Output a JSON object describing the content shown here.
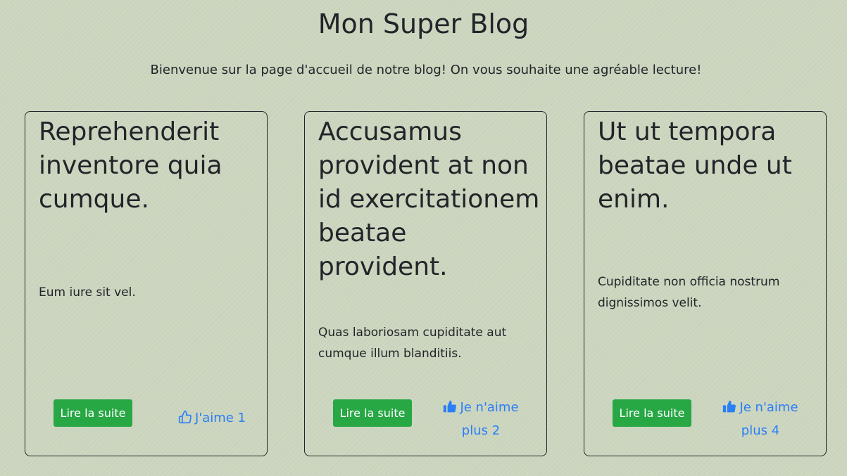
{
  "header": {
    "title": "Mon Super Blog",
    "subtitle": "Bienvenue sur la page d'accueil de notre blog! On vous souhaite une agréable lecture!"
  },
  "colors": {
    "background": "#ccd6bf",
    "button": "#28a745",
    "link": "#2a7ef7"
  },
  "posts": [
    {
      "title": "Reprehenderit inventore quia cumque.",
      "excerpt": "Eum iure sit vel.",
      "read_more_label": "Lire la suite",
      "like_label": "J'aime 1",
      "like_icon": "thumbs-up-outline-icon",
      "liked": false
    },
    {
      "title": "Accusamus provident at non id exercitationem beatae provident.",
      "excerpt": "Quas laboriosam cupiditate aut cumque illum blanditiis.",
      "read_more_label": "Lire la suite",
      "like_label": "Je n'aime plus 2",
      "like_icon": "thumbs-up-filled-icon",
      "liked": true
    },
    {
      "title": "Ut ut tempora beatae unde ut enim.",
      "excerpt": "Cupiditate non officia nostrum dignissimos velit.",
      "read_more_label": "Lire la suite",
      "like_label": "Je n'aime plus 4",
      "like_icon": "thumbs-up-filled-icon",
      "liked": true
    }
  ]
}
